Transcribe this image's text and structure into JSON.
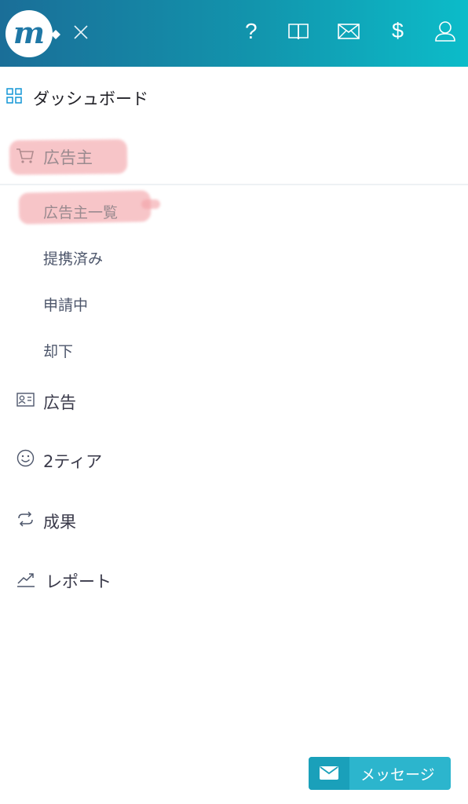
{
  "header": {
    "logo_letter": "m",
    "icons": [
      "close-icon",
      "help-icon",
      "book-icon",
      "mail-icon",
      "dollar-icon",
      "user-icon"
    ],
    "help_glyph": "?",
    "dollar_glyph": "$",
    "gradient": [
      "#1a6e98",
      "#0cbcc9"
    ]
  },
  "menu": {
    "dashboard": "ダッシュボード",
    "advertiser": "広告主",
    "advertiser_sub": [
      "広告主一覧",
      "提携済み",
      "申請中",
      "却下"
    ],
    "ads": "広告",
    "tier2": "2ティア",
    "results": "成果",
    "report": "レポート"
  },
  "message_button": {
    "label": "メッセージ"
  },
  "colors": {
    "accent": "#1296d6",
    "highlight": "#f3a3a8",
    "text": "#3a3a4a",
    "button": "#2cb5cd"
  }
}
